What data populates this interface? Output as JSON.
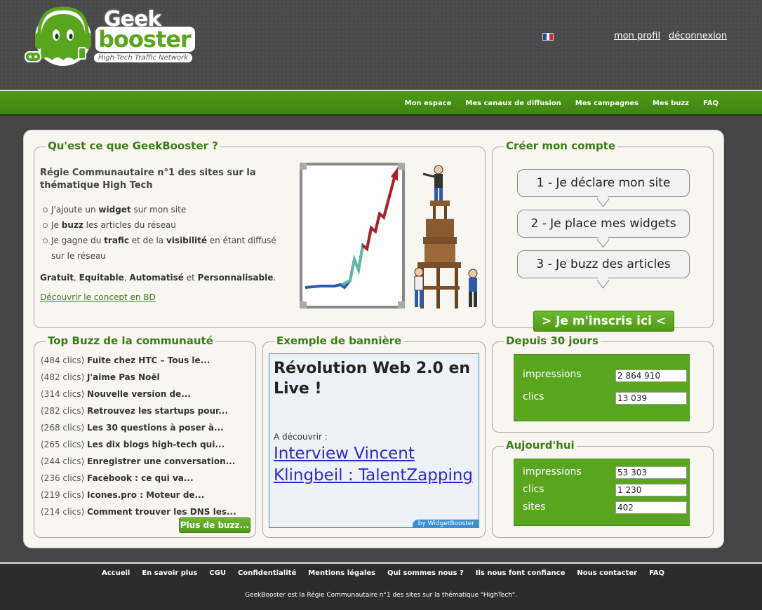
{
  "header": {
    "logo": {
      "word1": "Geek",
      "word2": "booster",
      "tagline": "High-Tech Traffic Network"
    },
    "language_flag": "fr-flag-icon",
    "links": {
      "profile": "mon profil",
      "logout": "déconnexion"
    }
  },
  "nav": {
    "items": [
      "Mon espace",
      "Mes canaux de diffusion",
      "Mes campagnes",
      "Mes buzz",
      "FAQ"
    ]
  },
  "about": {
    "title": "Qu'est ce que GeekBooster ?",
    "heading": "Régie Communautaire n°1 des sites sur la thématique High Tech",
    "bullets": [
      {
        "pre": "J'ajoute un ",
        "strong": "widget",
        "post": " sur mon site"
      },
      {
        "pre": "Je ",
        "strong": "buzz",
        "post": " les articles du réseau"
      },
      {
        "pre": "Je gagne du ",
        "strong": "trafic",
        "mid": " et de la ",
        "strong2": "visibilité",
        "post": " en étant diffusé sur le réseau"
      }
    ],
    "summary": {
      "w1": "Gratuit",
      "s1": ", ",
      "w2": "Equitable",
      "s2": ", ",
      "w3": "Automatisé",
      "s3": " et ",
      "w4": "Personnalisable",
      "s4": "."
    },
    "link": "Découvrir le concept en BD"
  },
  "create_account": {
    "title": "Créer mon compte",
    "steps": [
      "1 - Je déclare mon site",
      "2 - Je place mes widgets",
      "3 - Je buzz des articles"
    ],
    "signup_label": "> Je m'inscris ici <"
  },
  "top_buzz": {
    "title": "Top Buzz de la communauté",
    "items": [
      {
        "count": "(484 clics)",
        "title": "Fuite chez HTC – Tous le..."
      },
      {
        "count": "(482 clics)",
        "title": "J'aime Pas Noël"
      },
      {
        "count": "(314 clics)",
        "title": "Nouvelle version de..."
      },
      {
        "count": "(282 clics)",
        "title": "Retrouvez les startups pour..."
      },
      {
        "count": "(268 clics)",
        "title": "Les 30 questions à poser à..."
      },
      {
        "count": "(265 clics)",
        "title": "Les dix blogs high-tech qui..."
      },
      {
        "count": "(244 clics)",
        "title": "Enregistrer une conversation..."
      },
      {
        "count": "(236 clics)",
        "title": "Facebook : ce qui va..."
      },
      {
        "count": "(219 clics)",
        "title": "Icones.pro : Moteur de..."
      },
      {
        "count": "(214 clics)",
        "title": "Comment trouver les DNS les..."
      }
    ],
    "more_label": "Plus de buzz..."
  },
  "banner": {
    "title": "Exemple de bannière",
    "headline": "Révolution Web 2.0 en Live !",
    "label": "A découvrir :",
    "link": "Interview Vincent Klingbeil : TalentZapping",
    "credit": "by WidgetBooster"
  },
  "stats_30": {
    "title": "Depuis 30 jours",
    "impressions_label": "impressions",
    "impressions_value": "2 864 910",
    "clicks_label": "clics",
    "clicks_value": "13 039"
  },
  "stats_today": {
    "title": "Aujourd'hui",
    "impressions_label": "impressions",
    "impressions_value": "53 303",
    "clicks_label": "clics",
    "clicks_value": "1 230",
    "sites_label": "sites",
    "sites_value": "402"
  },
  "footer": {
    "links": [
      "Accueil",
      "En savoir plus",
      "CGU",
      "Confidentialité",
      "Mentions légales",
      "Qui sommes nous ?",
      "Ils nous font confiance",
      "Nous contacter",
      "FAQ"
    ],
    "tagline": "GeekBooster est la Régie Communautaire n°1 des sites sur la thématique \"HighTech\"."
  },
  "colors": {
    "brand_green": "#5aa51e",
    "title_green": "#3a7c14",
    "link_blue": "#2a2ad0"
  }
}
